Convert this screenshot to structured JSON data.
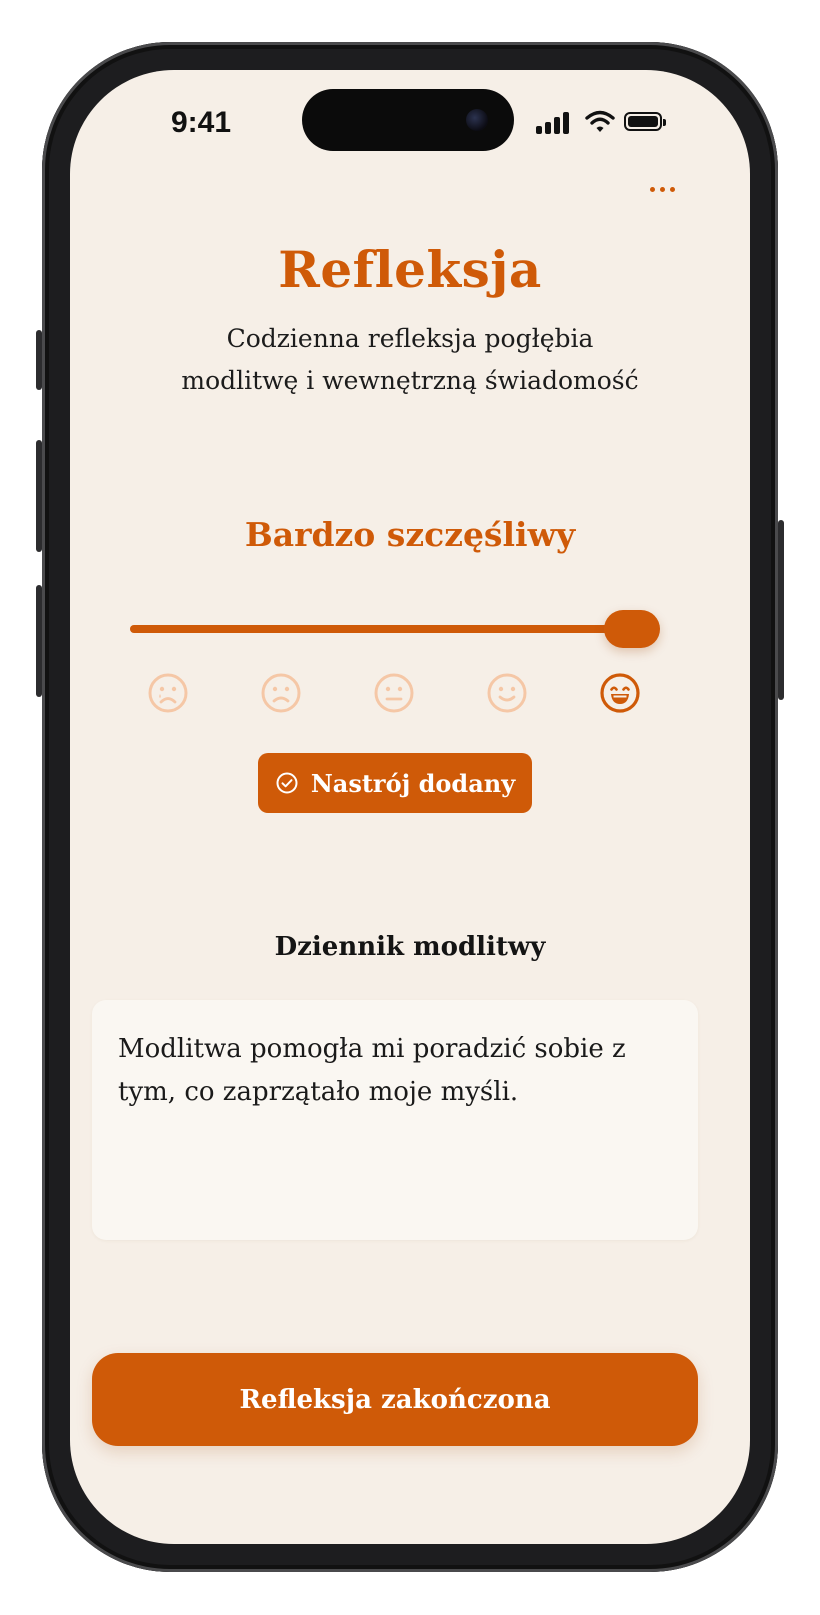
{
  "status_bar": {
    "time": "9:41"
  },
  "header": {
    "more_icon": "more-horizontal-icon"
  },
  "page": {
    "title": "Refleksja",
    "subtitle_line1": "Codzienna refleksja pogłębia",
    "subtitle_line2": "modlitwę i wewnętrzną świadomość"
  },
  "mood": {
    "selected_label": "Bardzo szczęśliwy",
    "slider_value": 1.0,
    "selected_index": 4,
    "faces": [
      "face-very-sad-icon",
      "face-sad-icon",
      "face-neutral-icon",
      "face-smile-icon",
      "face-grin-icon"
    ],
    "added_label": "Nastrój dodany",
    "added_icon": "check-circle-icon"
  },
  "journal": {
    "title": "Dziennik modlitwy",
    "entry_line1": "Modlitwa pomogła mi poradzić sobie z",
    "entry_line2": "tym, co zaprzątało moje myśli."
  },
  "footer": {
    "finish_label": "Refleksja zakończona"
  },
  "colors": {
    "accent": "#cf5a08",
    "background": "#f6efe7",
    "face_inactive": "#f5c7a6",
    "card": "#faf7f2"
  }
}
